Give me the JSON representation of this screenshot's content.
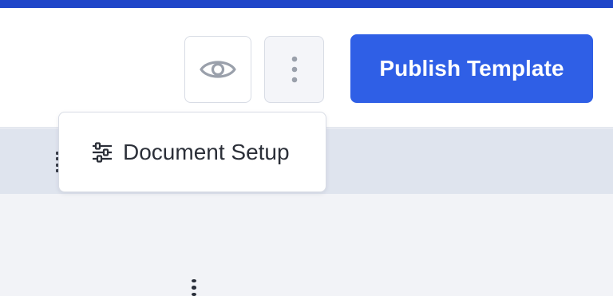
{
  "header": {
    "preview_icon": "eye-icon",
    "more_icon": "more-vertical-icon",
    "publish_label": "Publish Template"
  },
  "dropdown": {
    "items": [
      {
        "label": "Document Setup",
        "icon": "sliders-icon"
      }
    ]
  },
  "colors": {
    "accent": "#1f46c9",
    "primary_button": "#2f5fe6",
    "toolbar_band": "#dfe4ee",
    "canvas": "#f2f3f7"
  }
}
